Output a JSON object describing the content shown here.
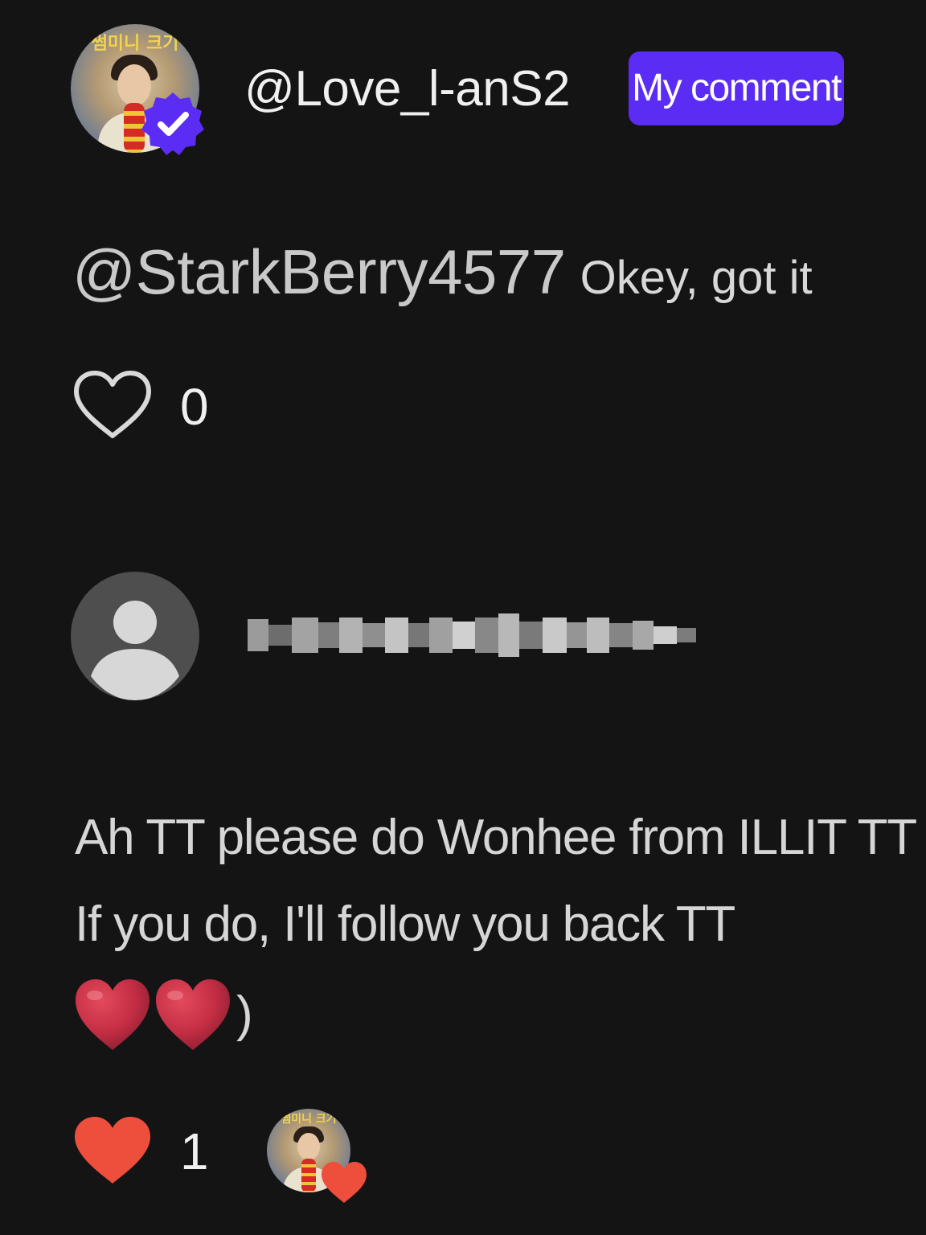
{
  "colors": {
    "background": "#151415",
    "badge": "#5b2cf3",
    "like_red": "#ee4e3c",
    "verified_blue": "#5b2cf3"
  },
  "comment1": {
    "username": "@Love_l-anS2",
    "badge_label": "My comment",
    "avatar_icon": "profile-photo",
    "verified_icon": "verified-check-icon",
    "mention": "@StarkBerry4577",
    "reply_text": "Okey, got it",
    "like_icon": "heart-outline-icon",
    "like_count": "0"
  },
  "comment2": {
    "avatar_icon": "default-user-icon",
    "username_pixelated": true,
    "lines": [
      "Ah TT please do Wonhee from ILLIT TT",
      "If you do, I'll follow you back TT"
    ],
    "emoji": [
      "red-heart-emoji",
      "red-heart-emoji"
    ],
    "trailing_text": ")",
    "like_icon": "heart-filled-icon",
    "like_count": "1",
    "creator_liked_icon": "creator-liked-avatar"
  }
}
